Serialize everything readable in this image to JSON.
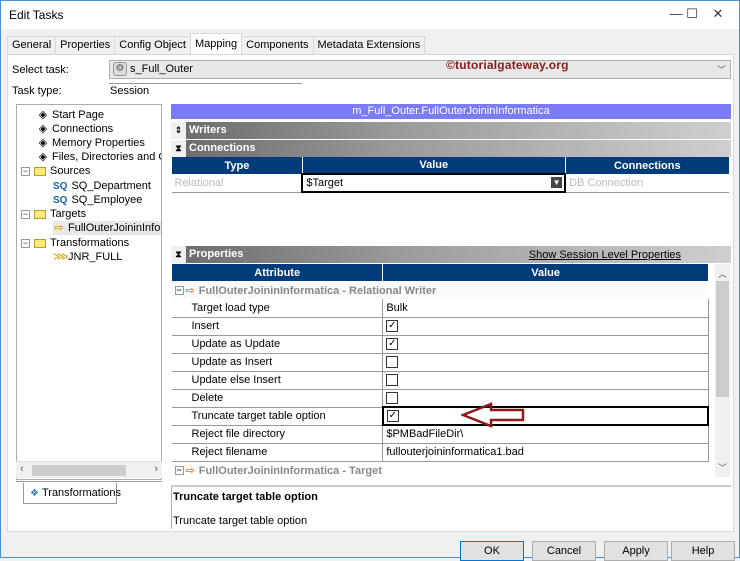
{
  "window": {
    "title": "Edit Tasks",
    "controls": {
      "minimize": "—",
      "maximize": "☐",
      "close": "✕"
    }
  },
  "tabs": [
    {
      "label": "General",
      "active": false
    },
    {
      "label": "Properties",
      "active": false
    },
    {
      "label": "Config Object",
      "active": false
    },
    {
      "label": "Mapping",
      "active": true
    },
    {
      "label": "Components",
      "active": false
    },
    {
      "label": "Metadata Extensions",
      "active": false
    }
  ],
  "select_task": {
    "label": "Select task:",
    "value": "s_Full_Outer"
  },
  "task_type": {
    "label": "Task type:",
    "value": "Session"
  },
  "watermark": "©tutorialgateway.org",
  "tree": {
    "items": [
      {
        "label": "Start Page",
        "icon": "page-icon"
      },
      {
        "label": "Connections",
        "icon": "page-icon"
      },
      {
        "label": "Memory Properties",
        "icon": "page-icon"
      },
      {
        "label": "Files, Directories and Com",
        "icon": "page-icon"
      }
    ],
    "sources": {
      "label": "Sources",
      "children": [
        "SQ_Department",
        "SQ_Employee"
      ]
    },
    "targets": {
      "label": "Targets",
      "children": [
        "FullOuterJoininInform"
      ]
    },
    "transformations": {
      "label": "Transformations",
      "children": [
        "JNR_FULL"
      ]
    }
  },
  "bottom_tab": "Transformations",
  "mapping_header": "m_Full_Outer.FullOuterJoininInformatica",
  "writers_label": "Writers",
  "connections_label": "Connections",
  "connections_table": {
    "headers": [
      "Type",
      "Value",
      "Connections"
    ],
    "row": {
      "type": "Relational",
      "value": "$Target",
      "connection": "DB Connection"
    }
  },
  "properties_label": "Properties",
  "show_session_link": "Show Session Level Properties",
  "properties_table": {
    "headers": [
      "Attribute",
      "Value"
    ],
    "group1": "FullOuterJoininInformatica - Relational Writer",
    "rows": [
      {
        "attr": "Target load type",
        "type": "text",
        "value": "Bulk"
      },
      {
        "attr": "Insert",
        "type": "check",
        "checked": true
      },
      {
        "attr": "Update as Update",
        "type": "check",
        "checked": true
      },
      {
        "attr": "Update as Insert",
        "type": "check",
        "checked": false
      },
      {
        "attr": "Update else Insert",
        "type": "check",
        "checked": false
      },
      {
        "attr": "Delete",
        "type": "check",
        "checked": false
      },
      {
        "attr": "Truncate target table option",
        "type": "check",
        "checked": true,
        "selected": true
      },
      {
        "attr": "Reject file directory",
        "type": "text",
        "value": "$PMBadFileDir\\"
      },
      {
        "attr": "Reject filename",
        "type": "text",
        "value": "fullouterjoininformatica1.bad"
      }
    ],
    "group2": "FullOuterJoininInformatica - Target"
  },
  "description": {
    "title": "Truncate target table option",
    "body": "Truncate target table option"
  },
  "buttons": {
    "ok": "OK",
    "cancel": "Cancel",
    "apply": "Apply",
    "help": "Help"
  },
  "colors": {
    "header_blue": "#003b7a",
    "mapping_header": "#7b7bf7",
    "annotation": "#8b1a1a"
  }
}
